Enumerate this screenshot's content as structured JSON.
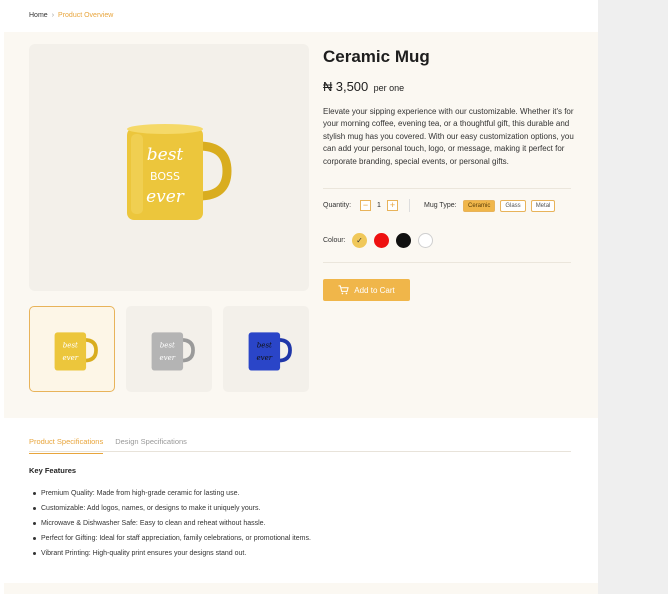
{
  "breadcrumb": {
    "home": "Home",
    "separator": "›",
    "current": "Product Overview"
  },
  "product": {
    "title": "Ceramic Mug",
    "currency": "₦",
    "price": "3,500",
    "price_unit": "per one",
    "description": "Elevate your sipping experience with our customizable. Whether it's for your morning coffee, evening tea, or a thoughtful gift, this durable and stylish mug has you covered. With our easy customization options, you can add your personal touch, logo, or message, making it perfect for corporate branding, special events, or personal gifts.",
    "mug_print_text": "best boss ever"
  },
  "quantity": {
    "label": "Quantity:",
    "value": "1",
    "minus": "−",
    "plus": "+"
  },
  "mug_type": {
    "label": "Mug Type:",
    "options": [
      "Ceramic",
      "Glass",
      "Metal"
    ],
    "selected": "Ceramic"
  },
  "colour": {
    "label": "Colour:",
    "options": [
      {
        "name": "yellow",
        "hex": "#f0c85a",
        "selected": true
      },
      {
        "name": "red",
        "hex": "#ee1111",
        "selected": false
      },
      {
        "name": "black",
        "hex": "#111111",
        "selected": false
      },
      {
        "name": "white",
        "hex": "#ffffff",
        "selected": false
      }
    ],
    "check": "✓"
  },
  "cart": {
    "label": "Add to Cart"
  },
  "thumbnails": [
    {
      "color": "yellow",
      "hex": "#ecc63c"
    },
    {
      "color": "grey",
      "hex": "#b4b4b4"
    },
    {
      "color": "blue",
      "hex": "#2a45c8"
    }
  ],
  "tabs": [
    "Product  Specifications",
    "Design Specifications"
  ],
  "features": {
    "heading": "Key Features",
    "items": [
      "Premium Quality: Made from high-grade ceramic for lasting use.",
      "Customizable: Add logos, names, or designs to make it uniquely yours.",
      "Microwave & Dishwasher Safe: Easy to clean and reheat without hassle.",
      "Perfect for Gifting: Ideal for staff appreciation, family celebrations, or promotional items.",
      "Vibrant Printing: High-quality print ensures your designs stand out."
    ]
  },
  "colors": {
    "accent": "#e8a53c",
    "button": "#f0b64a",
    "panel": "#fbf8f2"
  }
}
